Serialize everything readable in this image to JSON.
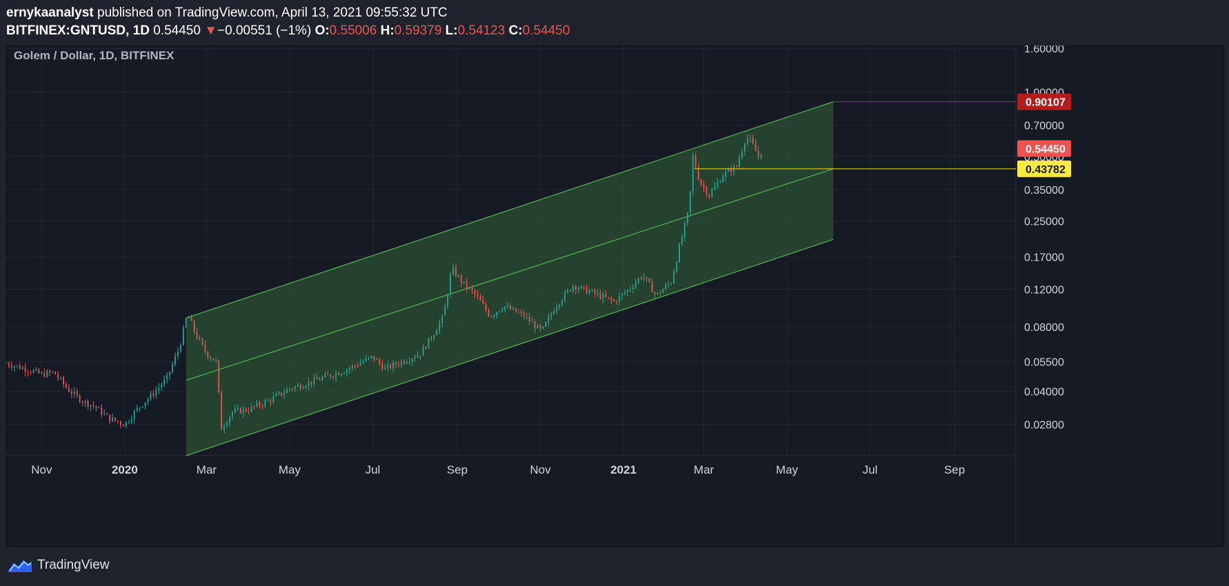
{
  "header": {
    "author": "ernykaanalyst",
    "published_text": "published on TradingView.com, April 13, 2021 09:55:32 UTC",
    "symbol": "BITFINEX:GNTUSD, 1D",
    "price": "0.54450",
    "change": "−0.00551 (−1%)",
    "o_label": "O:",
    "o_value": "0.55006",
    "h_label": "H:",
    "h_value": "0.59379",
    "l_label": "L:",
    "l_value": "0.54123",
    "c_label": "C:",
    "c_value": "0.54450",
    "down_arrow": "▼"
  },
  "legend_title": "Golem / Dollar, 1D, BITFINEX",
  "footer": {
    "brand": "TradingView",
    "logo_icon": "tradingview-logo-icon"
  },
  "colors": {
    "background": "#161a25",
    "grid": "#232734",
    "axis_text": "#d1d4dc",
    "candle_up": "#26a69a",
    "candle_down": "#ef5350",
    "channel_line": "#4caf50",
    "channel_fill": "#2e5d33",
    "target_label": "#b71c1c",
    "current_label": "#ef5350",
    "support_label": "#ffeb3b"
  },
  "chart_data": {
    "type": "candlestick",
    "title": "Golem / Dollar, 1D, BITFINEX",
    "y_scale": "log",
    "x_tick_labels": [
      "Nov",
      "2020",
      "Mar",
      "May",
      "Jul",
      "Sep",
      "Nov",
      "2021",
      "Mar",
      "May",
      "Jul",
      "Sep"
    ],
    "x_ticks": [
      {
        "label": "Nov",
        "date": "2019-11-01"
      },
      {
        "label": "2020",
        "date": "2020-01-01"
      },
      {
        "label": "Mar",
        "date": "2020-03-01"
      },
      {
        "label": "May",
        "date": "2020-05-01"
      },
      {
        "label": "Jul",
        "date": "2020-07-01"
      },
      {
        "label": "Sep",
        "date": "2020-09-01"
      },
      {
        "label": "Nov",
        "date": "2020-11-01"
      },
      {
        "label": "2021",
        "date": "2021-01-01"
      },
      {
        "label": "Mar",
        "date": "2021-03-01"
      },
      {
        "label": "May",
        "date": "2021-05-01"
      },
      {
        "label": "Jul",
        "date": "2021-07-01"
      },
      {
        "label": "Sep",
        "date": "2021-09-01"
      }
    ],
    "x_range": [
      "2019-10-06",
      "2021-10-16"
    ],
    "y_tick_labels": [
      "1.60000",
      "1.00000",
      "0.70000",
      "0.50000",
      "0.35000",
      "0.25000",
      "0.17000",
      "0.12000",
      "0.08000",
      "0.05500",
      "0.04000",
      "0.02800"
    ],
    "y_ticks": [
      1.6,
      1.0,
      0.7,
      0.5,
      0.35,
      0.25,
      0.17,
      0.12,
      0.08,
      0.055,
      0.04,
      0.028
    ],
    "ylim": [
      0.02,
      1.65
    ],
    "price_path": [
      {
        "date": "2019-10-06",
        "price": 0.054
      },
      {
        "date": "2019-10-20",
        "price": 0.051
      },
      {
        "date": "2019-11-01",
        "price": 0.048
      },
      {
        "date": "2019-11-10",
        "price": 0.049
      },
      {
        "date": "2019-11-20",
        "price": 0.041
      },
      {
        "date": "2019-12-01",
        "price": 0.036
      },
      {
        "date": "2019-12-10",
        "price": 0.034
      },
      {
        "date": "2019-12-20",
        "price": 0.03
      },
      {
        "date": "2020-01-01",
        "price": 0.028
      },
      {
        "date": "2020-01-10",
        "price": 0.033
      },
      {
        "date": "2020-01-20",
        "price": 0.038
      },
      {
        "date": "2020-02-01",
        "price": 0.046
      },
      {
        "date": "2020-02-10",
        "price": 0.064
      },
      {
        "date": "2020-02-16",
        "price": 0.092
      },
      {
        "date": "2020-02-22",
        "price": 0.074
      },
      {
        "date": "2020-03-01",
        "price": 0.06
      },
      {
        "date": "2020-03-08",
        "price": 0.055
      },
      {
        "date": "2020-03-12",
        "price": 0.027
      },
      {
        "date": "2020-03-20",
        "price": 0.032
      },
      {
        "date": "2020-04-01",
        "price": 0.033
      },
      {
        "date": "2020-04-15",
        "price": 0.036
      },
      {
        "date": "2020-05-01",
        "price": 0.041
      },
      {
        "date": "2020-05-20",
        "price": 0.045
      },
      {
        "date": "2020-06-10",
        "price": 0.05
      },
      {
        "date": "2020-07-01",
        "price": 0.058
      },
      {
        "date": "2020-07-10",
        "price": 0.051
      },
      {
        "date": "2020-07-25",
        "price": 0.056
      },
      {
        "date": "2020-08-05",
        "price": 0.06
      },
      {
        "date": "2020-08-15",
        "price": 0.075
      },
      {
        "date": "2020-08-22",
        "price": 0.09
      },
      {
        "date": "2020-08-28",
        "price": 0.15
      },
      {
        "date": "2020-09-05",
        "price": 0.128
      },
      {
        "date": "2020-09-15",
        "price": 0.112
      },
      {
        "date": "2020-09-25",
        "price": 0.09
      },
      {
        "date": "2020-10-05",
        "price": 0.1
      },
      {
        "date": "2020-10-20",
        "price": 0.09
      },
      {
        "date": "2020-11-02",
        "price": 0.076
      },
      {
        "date": "2020-11-12",
        "price": 0.1
      },
      {
        "date": "2020-11-25",
        "price": 0.125
      },
      {
        "date": "2020-12-10",
        "price": 0.115
      },
      {
        "date": "2020-12-25",
        "price": 0.105
      },
      {
        "date": "2021-01-05",
        "price": 0.12
      },
      {
        "date": "2021-01-15",
        "price": 0.14
      },
      {
        "date": "2021-01-25",
        "price": 0.112
      },
      {
        "date": "2021-02-05",
        "price": 0.13
      },
      {
        "date": "2021-02-12",
        "price": 0.2
      },
      {
        "date": "2021-02-18",
        "price": 0.28
      },
      {
        "date": "2021-02-21",
        "price": 0.5
      },
      {
        "date": "2021-02-26",
        "price": 0.38
      },
      {
        "date": "2021-03-05",
        "price": 0.33
      },
      {
        "date": "2021-03-15",
        "price": 0.41
      },
      {
        "date": "2021-03-25",
        "price": 0.45
      },
      {
        "date": "2021-04-01",
        "price": 0.62
      },
      {
        "date": "2021-04-05",
        "price": 0.58
      },
      {
        "date": "2021-04-10",
        "price": 0.5
      },
      {
        "date": "2021-04-13",
        "price": 0.5445
      }
    ],
    "channel": {
      "start_date": "2020-02-15",
      "end_date": "2021-06-04",
      "upper": [
        0.088,
        0.901
      ],
      "middle": [
        0.045,
        0.4378
      ],
      "lower": [
        0.02,
        0.205
      ]
    },
    "horizontal_lines": [
      {
        "name": "target",
        "price": 0.90107,
        "from_date": "2021-06-04"
      },
      {
        "name": "support",
        "price": 0.43782,
        "from_date": "2021-02-22"
      }
    ],
    "price_labels": [
      {
        "name": "target-price-label",
        "text": "0.90107",
        "price": 0.90107,
        "color": "#b71c1c"
      },
      {
        "name": "current-price-label",
        "text": "0.54450",
        "price": 0.5445,
        "color": "#ef5350"
      },
      {
        "name": "support-price-label",
        "text": "0.43782",
        "price": 0.43782,
        "color": "#ffeb3b"
      }
    ]
  }
}
